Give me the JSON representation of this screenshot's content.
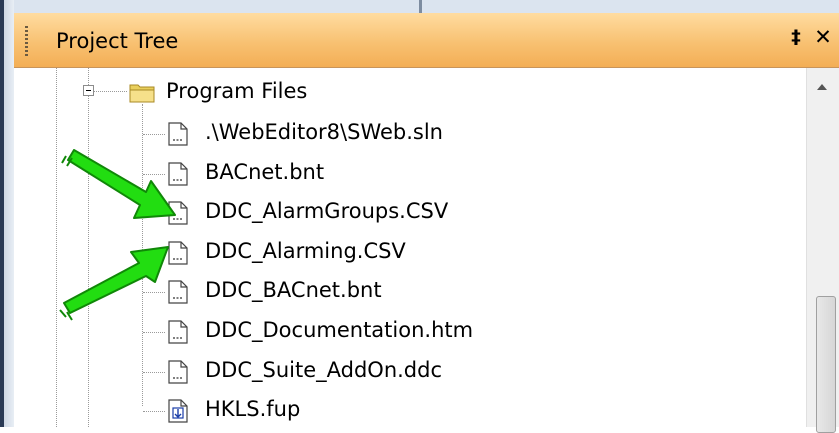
{
  "panel": {
    "title": "Project Tree",
    "pin_glyph": "‡",
    "close_glyph": "✕"
  },
  "tree": {
    "folder": {
      "label": "Program Files",
      "icon": "folder-icon",
      "expanded": true
    },
    "files": [
      {
        "label": ".\\WebEditor8\\SWeb.sln",
        "icon": "document-icon"
      },
      {
        "label": "BACnet.bnt",
        "icon": "document-icon"
      },
      {
        "label": "DDC_AlarmGroups.CSV",
        "icon": "document-icon"
      },
      {
        "label": "DDC_Alarming.CSV",
        "icon": "document-icon"
      },
      {
        "label": "DDC_BACnet.bnt",
        "icon": "document-icon"
      },
      {
        "label": "DDC_Documentation.htm",
        "icon": "document-icon"
      },
      {
        "label": "DDC_Suite_AddOn.ddc",
        "icon": "document-icon"
      },
      {
        "label": "HKLS.fup",
        "icon": "function-plan-icon"
      }
    ]
  },
  "annotations": {
    "arrow_color": "#22dd11",
    "arrow_targets": [
      "DDC_AlarmGroups.CSV",
      "DDC_Alarming.CSV"
    ]
  }
}
